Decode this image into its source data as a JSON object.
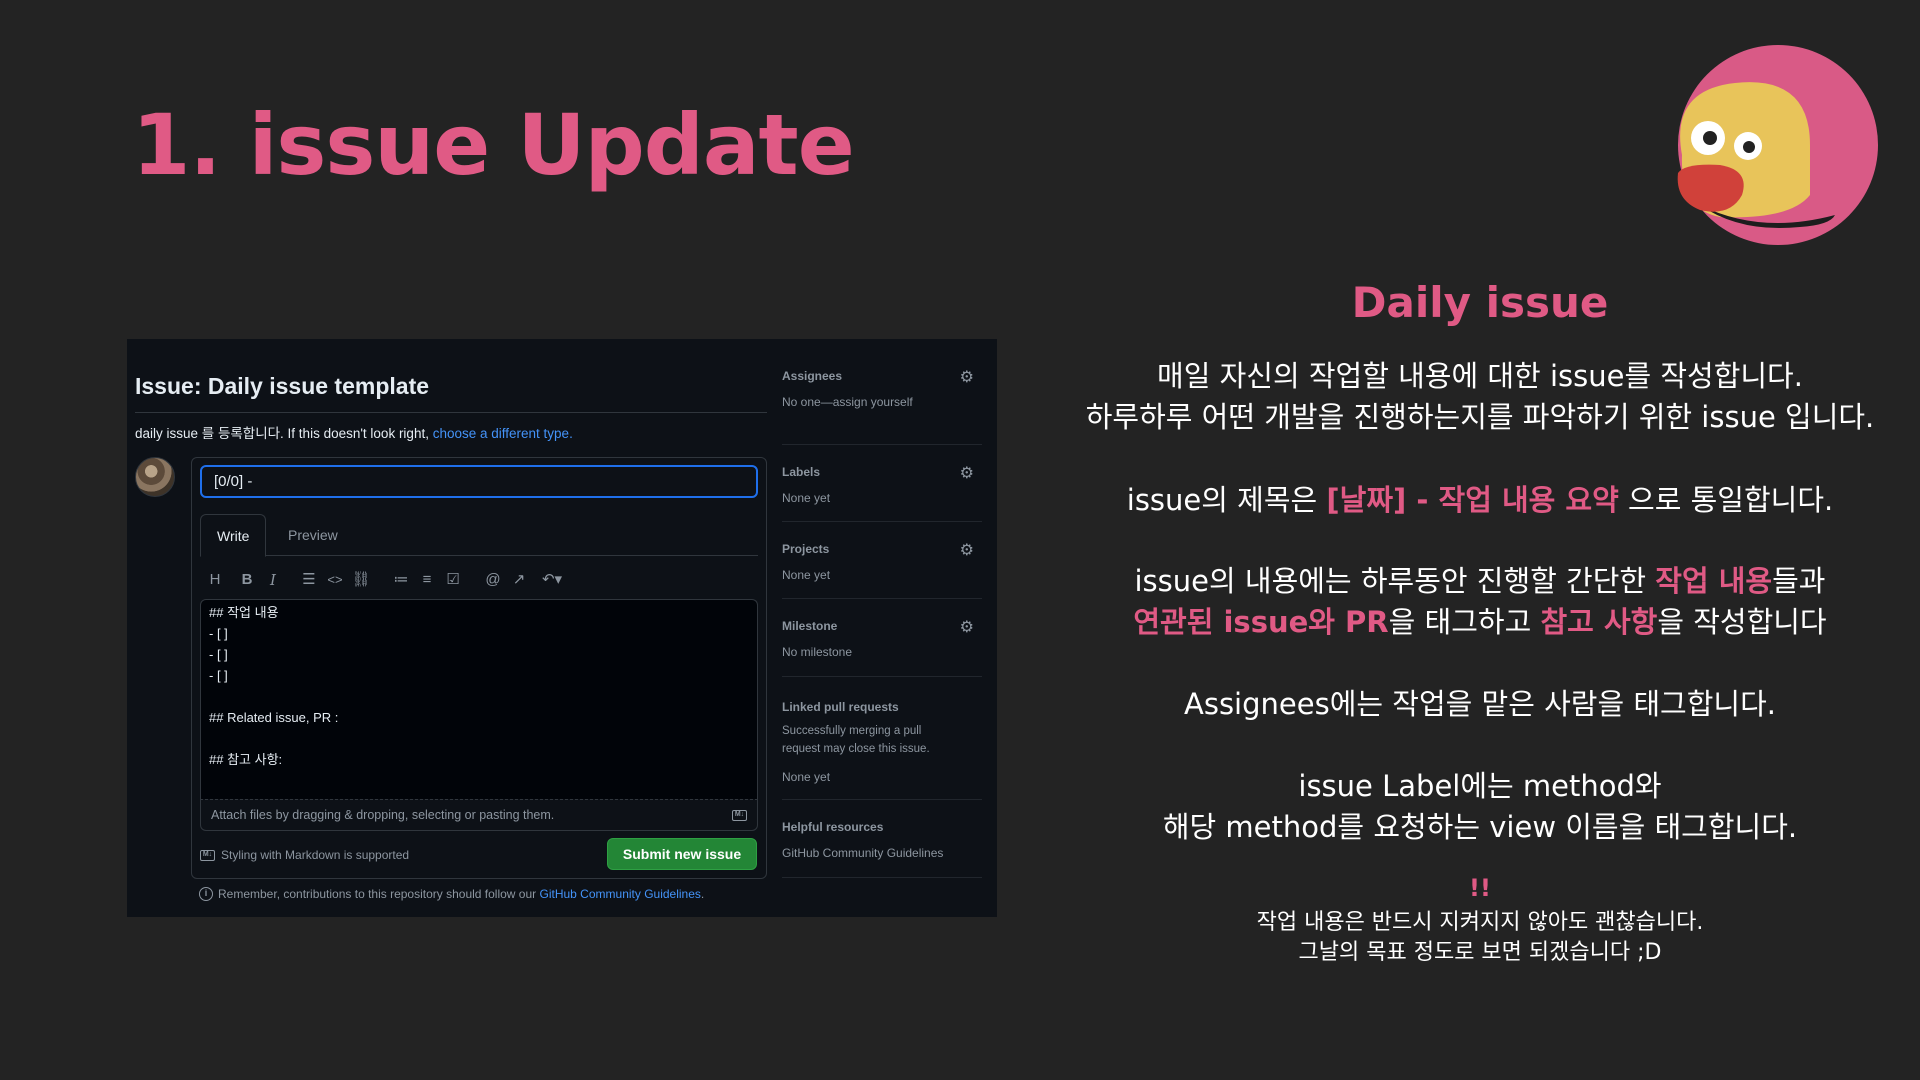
{
  "slide": {
    "title": "1. issue Update",
    "section_title": "Daily issue",
    "p1_line1": "매일 자신의 작업할 내용에 대한 issue를 작성합니다.",
    "p1_line2": "하루하루 어떤 개발을 진행하는지를 파악하기 위한 issue 입니다.",
    "p2_a": "issue의 제목은 ",
    "p2_hl": "[날짜] - 작업 내용 요약",
    "p2_b": " 으로 통일합니다.",
    "p3_a": "issue의 내용에는 하루동안 진행할 간단한 ",
    "p3_hl1": "작업 내용",
    "p3_b": "들과",
    "p3_hl2": "연관된 issue와 PR",
    "p3_c": "을 태그하고 ",
    "p3_hl3": "참고 사항",
    "p3_d": "을 작성합니다",
    "p4": "Assignees에는 작업을 맡은 사람을 태그합니다.",
    "p5_line1": "issue Label에는 method와",
    "p5_line2": "해당 method를 요청하는 view 이름을 태그합니다.",
    "note_mark": "!!",
    "note_line1": "작업 내용은 반드시 지켜지지 않아도 괜찮습니다.",
    "note_line2": "그날의 목표 정도로 보면 되겠습니다 ;D"
  },
  "github": {
    "title": "Issue: Daily issue template",
    "subtitle_text": "daily issue 를 등록합니다. If this doesn't look right, ",
    "subtitle_link": "choose a different type.",
    "issue_title_value": "[0/0] -",
    "tabs": [
      "Write",
      "Preview"
    ],
    "toolbar_icons": [
      "heading-icon",
      "bold-icon",
      "italic-icon",
      "quote-icon",
      "code-icon",
      "link-icon",
      "unordered-list-icon",
      "ordered-list-icon",
      "task-list-icon",
      "mention-icon",
      "reference-icon",
      "undo-icon"
    ],
    "body_lines": [
      "## 작업 내용",
      "- [ ]",
      "- [ ]",
      "- [ ]",
      "",
      "## Related issue, PR :",
      "",
      "## 참고 사항:"
    ],
    "attach_hint": "Attach files by dragging & dropping, selecting or pasting them.",
    "markdown_note": "Styling with Markdown is supported",
    "submit_label": "Submit new issue",
    "remember_text": "Remember, contributions to this repository should follow our ",
    "remember_link": "GitHub Community Guidelines",
    "remember_end": ".",
    "sidebar": {
      "assignees_h": "Assignees",
      "assignees_v": "No one—assign yourself",
      "labels_h": "Labels",
      "labels_v": "None yet",
      "projects_h": "Projects",
      "projects_v": "None yet",
      "milestone_h": "Milestone",
      "milestone_v": "No milestone",
      "linked_h": "Linked pull requests",
      "linked_desc1": "Successfully merging a pull",
      "linked_desc2": "request may close this issue.",
      "linked_v": "None yet",
      "helpful_h": "Helpful resources",
      "helpful_link": "GitHub Community Guidelines"
    }
  },
  "colors": {
    "accent": "#e05a85",
    "background": "#232323",
    "gh_bg": "#0d1117",
    "gh_link": "#4493f8",
    "gh_submit": "#238636"
  }
}
